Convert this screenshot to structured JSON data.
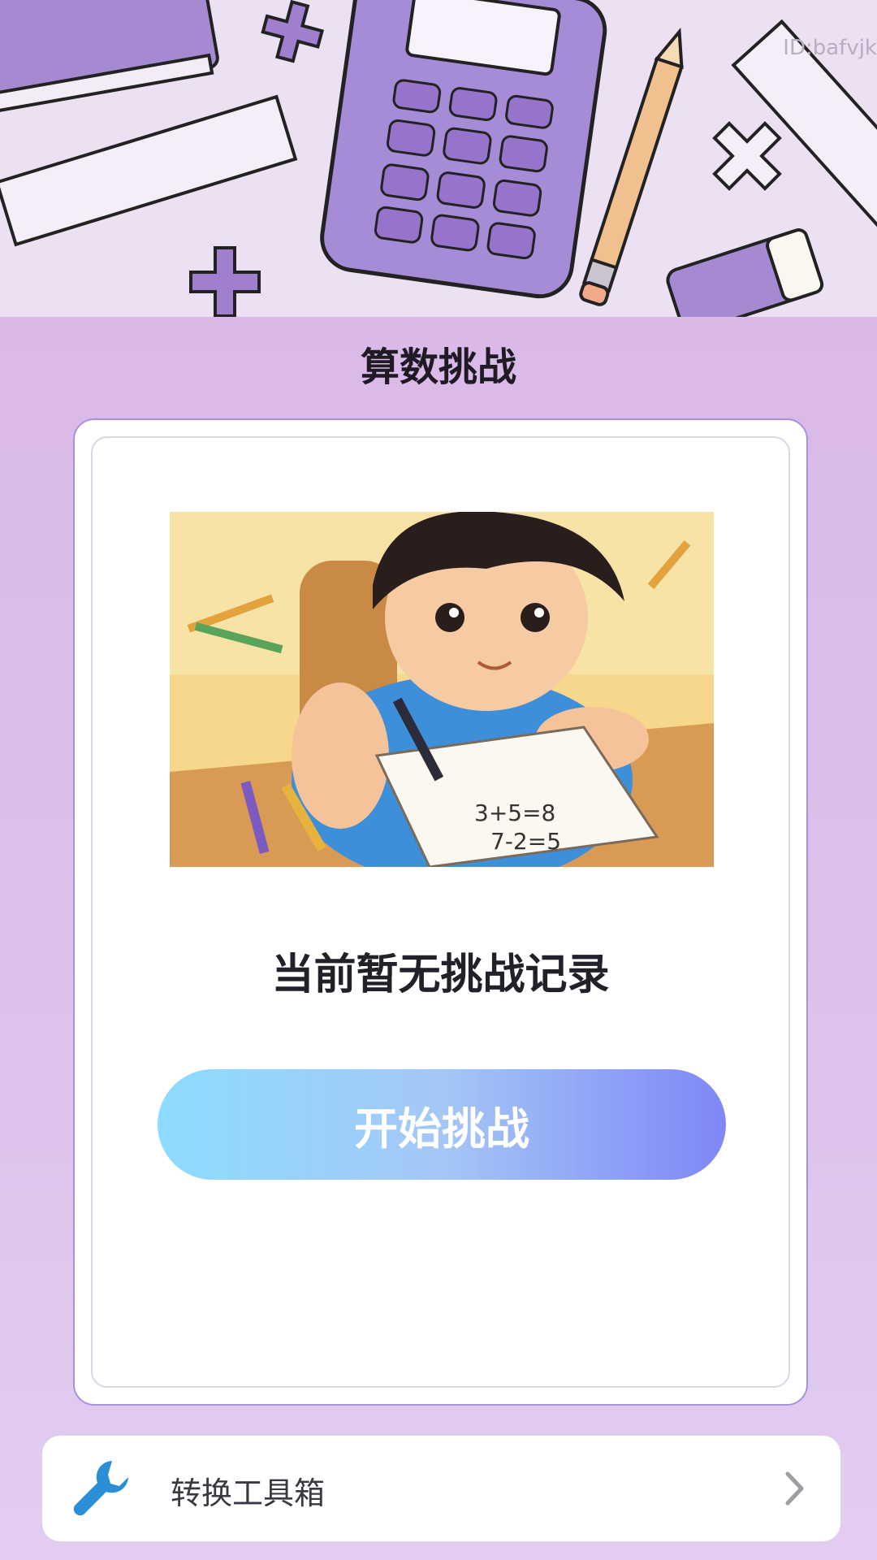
{
  "watermark": "ID:bafvjk",
  "header": {
    "title": "算数挑战"
  },
  "empty_state": {
    "message": "当前暂无挑战记录",
    "illustration_equations": [
      "3+5=8",
      "7-2=5"
    ]
  },
  "actions": {
    "start_label": "开始挑战"
  },
  "tools": {
    "label": "转换工具箱",
    "icon": "wrench-icon",
    "icon_color": "#2b8fd8"
  },
  "colors": {
    "accent_start": "#8ddcff",
    "accent_end": "#7f87f7",
    "background": "#d8b7e6"
  }
}
